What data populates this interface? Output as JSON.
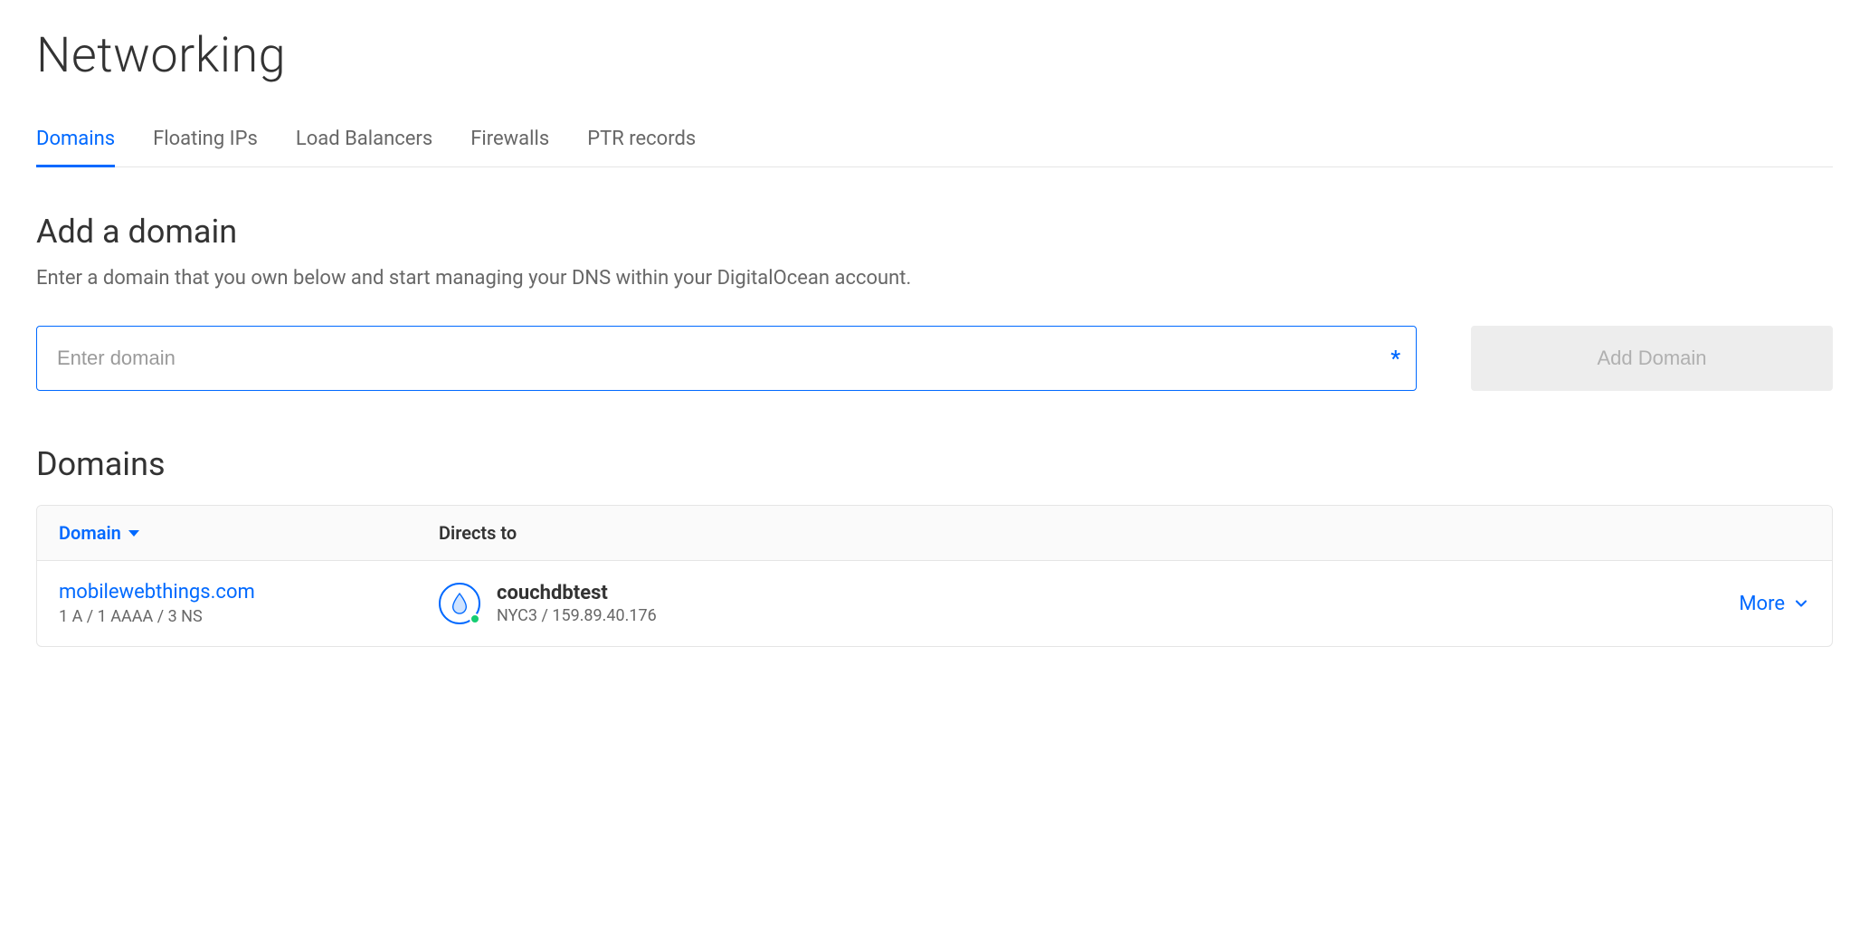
{
  "page": {
    "title": "Networking"
  },
  "tabs": [
    {
      "label": "Domains",
      "active": true
    },
    {
      "label": "Floating IPs",
      "active": false
    },
    {
      "label": "Load Balancers",
      "active": false
    },
    {
      "label": "Firewalls",
      "active": false
    },
    {
      "label": "PTR records",
      "active": false
    }
  ],
  "addDomain": {
    "heading": "Add a domain",
    "description": "Enter a domain that you own below and start managing your DNS within your DigitalOcean account.",
    "placeholder": "Enter domain",
    "requiredMark": "*",
    "buttonLabel": "Add Domain"
  },
  "domainsSection": {
    "heading": "Domains",
    "columns": {
      "domain": "Domain",
      "directsTo": "Directs to"
    },
    "moreLabel": "More",
    "rows": [
      {
        "domain": "mobilewebthings.com",
        "records": "1 A / 1 AAAA / 3 NS",
        "dropletName": "couchdbtest",
        "region": "NYC3",
        "ip": "159.89.40.176",
        "meta": "NYC3 / 159.89.40.176"
      }
    ]
  }
}
